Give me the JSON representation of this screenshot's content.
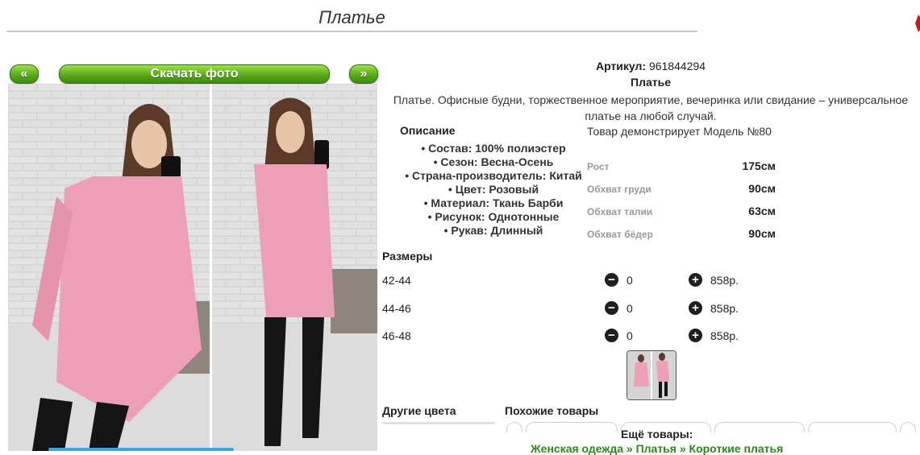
{
  "page": {
    "title": "Платье"
  },
  "gallery": {
    "prev_label": "«",
    "download_label": "Скачать фото",
    "next_label": "»"
  },
  "product": {
    "article_label": "Артикул:",
    "article_value": "961844294",
    "name": "Платье",
    "description_line1": "Платье. Офисные будни, торжественное мероприятие, вечеринка или свидание – универсальное",
    "description_line2": "платье на любой случай.",
    "description_heading": "Описание",
    "model_heading": "Товар демонстрирует Модель №80",
    "properties": [
      "Состав: 100% полиэстер",
      "Сезон: Весна-Осень",
      "Страна-производитель: Китай",
      "Цвет: Розовый",
      "Материал: Ткань Барби",
      "Рисунок: Однотонные",
      "Рукав: Длинный"
    ],
    "measurements": [
      {
        "label": "Рост",
        "value": "175см"
      },
      {
        "label": "Обхват груди",
        "value": "90см"
      },
      {
        "label": "Обхват талии",
        "value": "63см"
      },
      {
        "label": "Обхват бёдер",
        "value": "90см"
      }
    ]
  },
  "sizes": {
    "heading": "Размеры",
    "minus_icon": "−",
    "plus_icon": "+",
    "rows": [
      {
        "size": "42-44",
        "qty": "0",
        "price": "858р."
      },
      {
        "size": "44-46",
        "qty": "0",
        "price": "858р."
      },
      {
        "size": "46-48",
        "qty": "0",
        "price": "858р."
      }
    ]
  },
  "related": {
    "other_colors_heading": "Другие цвета",
    "similar_heading": "Похожие товары",
    "more_heading": "Ещё товары:",
    "breadcrumb": [
      "Женская одежда",
      "Платья",
      "Короткие платья"
    ],
    "breadcrumb_sep": "»"
  },
  "colors": {
    "accent_green": "#5aa81c",
    "dress_pink": "#ee9fb8",
    "link_green": "#2a8a18"
  }
}
